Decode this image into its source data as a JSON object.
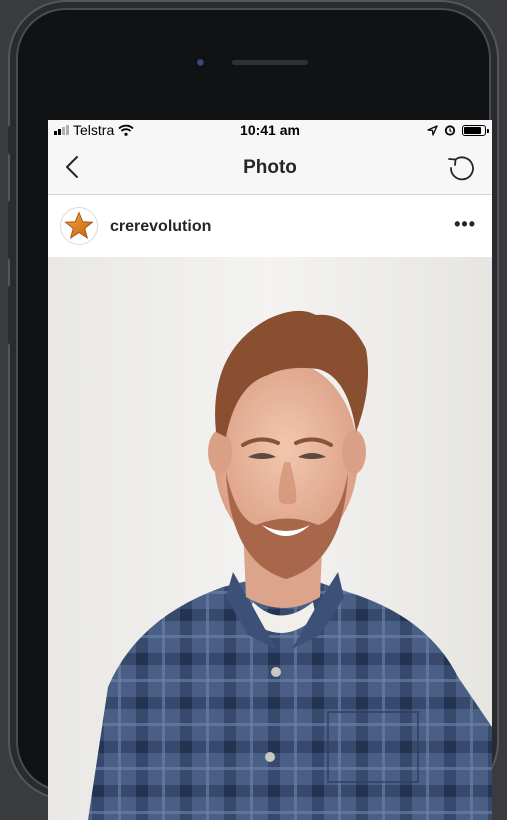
{
  "status_bar": {
    "carrier": "Telstra",
    "time": "10:41 am"
  },
  "nav": {
    "title": "Photo",
    "back_icon": "chevron-left-icon",
    "refresh_icon": "refresh-icon"
  },
  "post": {
    "username": "crerevolution",
    "avatar_icon": "star-icon",
    "more_label": "•••"
  },
  "colors": {
    "accent_star": "#e07b22",
    "shirt_blue": "#4a5f86"
  }
}
